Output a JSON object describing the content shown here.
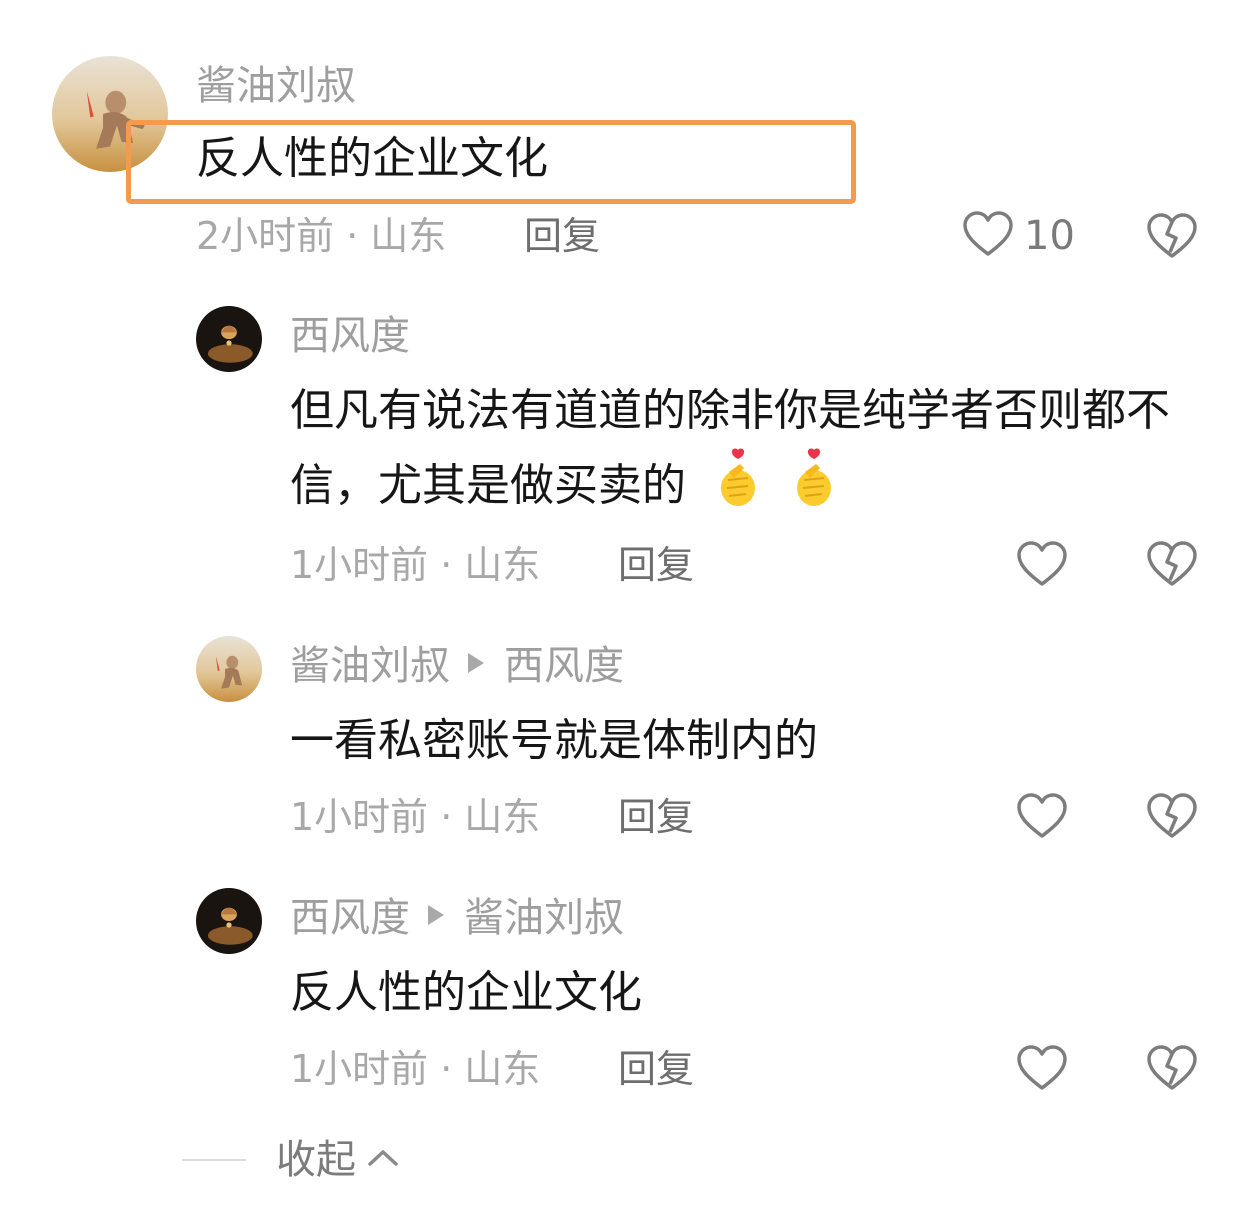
{
  "comments": [
    {
      "username": "酱油刘叔",
      "content": "反人性的企业文化",
      "time": "2小时前",
      "location": "山东",
      "reply_label": "回复",
      "like_count": "10"
    },
    {
      "username": "西风度",
      "content": "但凡有说法有道道的除非你是纯学者否则都不信，尤其是做买卖的",
      "time": "1小时前",
      "location": "山东",
      "reply_label": "回复"
    },
    {
      "username": "酱油刘叔",
      "reply_to": "西风度",
      "content": "一看私密账号就是体制内的",
      "time": "1小时前",
      "location": "山东",
      "reply_label": "回复"
    },
    {
      "username": "西风度",
      "reply_to": "酱油刘叔",
      "content": "反人性的企业文化",
      "time": "1小时前",
      "location": "山东",
      "reply_label": "回复"
    }
  ],
  "collapse_label": "收起",
  "highlight_color": "#f29a4e",
  "icons": {
    "like": "heart-outline-icon",
    "dislike": "broken-heart-icon",
    "emoji": "finger-heart-emoji",
    "collapse": "chevron-up-icon"
  }
}
